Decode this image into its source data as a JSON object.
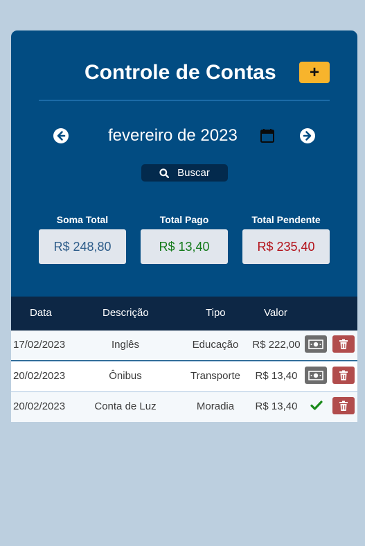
{
  "header": {
    "title": "Controle de Contas",
    "add_label": "+"
  },
  "nav": {
    "month_label": "fevereiro de 2023",
    "search_label": "Buscar"
  },
  "summary": [
    {
      "label": "Soma Total",
      "value": "R$ 248,80",
      "color": "#2e5d8a"
    },
    {
      "label": "Total Pago",
      "value": "R$ 13,40",
      "color": "#137a1a"
    },
    {
      "label": "Total Pendente",
      "value": "R$ 235,40",
      "color": "#b3121a"
    }
  ],
  "table": {
    "columns": [
      "Data",
      "Descrição",
      "Tipo",
      "Valor"
    ],
    "rows": [
      {
        "data": "17/02/2023",
        "descricao": "Inglês",
        "tipo": "Educação",
        "valor": "R$ 222,00",
        "status": "pendente",
        "status_icon": "money-icon"
      },
      {
        "data": "20/02/2023",
        "descricao": "Ônibus",
        "tipo": "Transporte",
        "valor": "R$ 13,40",
        "status": "pendente",
        "status_icon": "money-icon"
      },
      {
        "data": "20/02/2023",
        "descricao": "Conta de Luz",
        "tipo": "Moradia",
        "valor": "R$ 13,40",
        "status": "pago",
        "status_icon": "check-icon"
      }
    ]
  },
  "colors": {
    "page_bg": "#bccfdf",
    "card_bg": "#024c82",
    "table_head_bg": "#0d2745",
    "add_button": "#f7b42c",
    "delete_button": "#b14c4c",
    "pay_button": "#6d6d6d",
    "check": "#1a8a1a"
  },
  "icons": [
    "plus-icon",
    "arrow-left-icon",
    "arrow-right-icon",
    "calendar-icon",
    "search-icon",
    "money-icon",
    "trash-icon",
    "check-icon"
  ]
}
